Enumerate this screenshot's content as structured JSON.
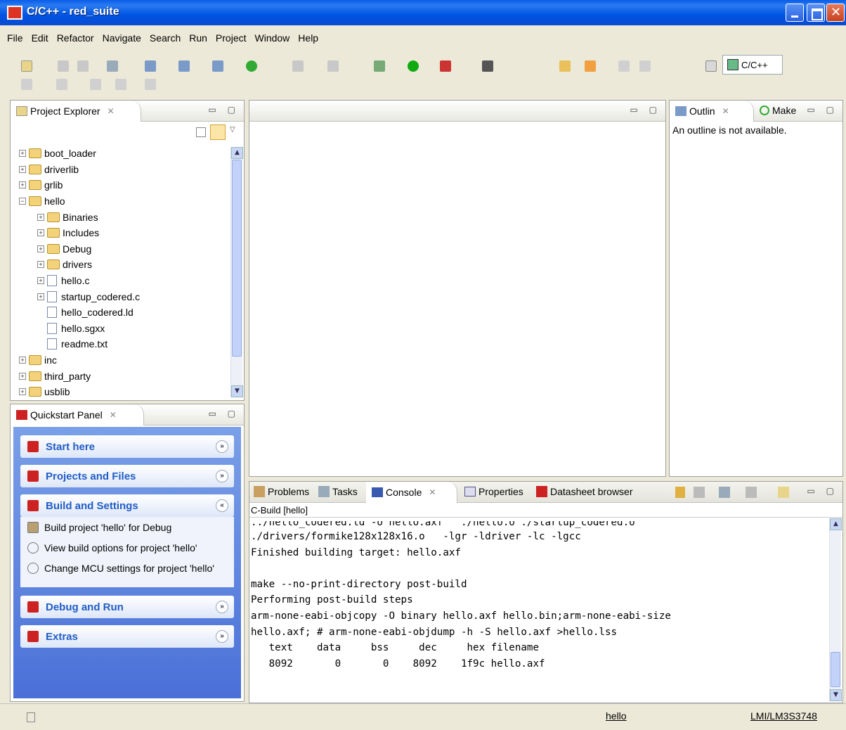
{
  "window": {
    "title": "C/C++ - red_suite"
  },
  "menu": [
    "File",
    "Edit",
    "Refactor",
    "Navigate",
    "Search",
    "Run",
    "Project",
    "Window",
    "Help"
  ],
  "perspective": {
    "label": "C/C++"
  },
  "project_explorer": {
    "tab": "Project Explorer",
    "tree": [
      {
        "label": "boot_loader",
        "expander": "+",
        "level": 0,
        "icon": "folder-icon"
      },
      {
        "label": "driverlib",
        "expander": "+",
        "level": 0,
        "icon": "c-project-icon"
      },
      {
        "label": "grlib",
        "expander": "+",
        "level": 0,
        "icon": "c-project-icon"
      },
      {
        "label": "hello",
        "expander": "−",
        "level": 0,
        "icon": "c-project-icon"
      },
      {
        "label": "Binaries",
        "expander": "+",
        "level": 1,
        "icon": "binaries-icon"
      },
      {
        "label": "Includes",
        "expander": "+",
        "level": 1,
        "icon": "includes-icon"
      },
      {
        "label": "Debug",
        "expander": "+",
        "level": 1,
        "icon": "folder-icon"
      },
      {
        "label": "drivers",
        "expander": "+",
        "level": 1,
        "icon": "folder-icon"
      },
      {
        "label": "hello.c",
        "expander": "+",
        "level": 1,
        "icon": "c-file-icon"
      },
      {
        "label": "startup_codered.c",
        "expander": "+",
        "level": 1,
        "icon": "c-file-icon"
      },
      {
        "label": "hello_codered.ld",
        "expander": "",
        "level": 1,
        "icon": "file-icon"
      },
      {
        "label": "hello.sgxx",
        "expander": "",
        "level": 1,
        "icon": "file-icon"
      },
      {
        "label": "readme.txt",
        "expander": "",
        "level": 1,
        "icon": "file-icon"
      },
      {
        "label": "inc",
        "expander": "+",
        "level": 0,
        "icon": "folder-icon"
      },
      {
        "label": "third_party",
        "expander": "+",
        "level": 0,
        "icon": "folder-icon"
      },
      {
        "label": "usblib",
        "expander": "+",
        "level": 0,
        "icon": "c-project-icon"
      }
    ]
  },
  "quickstart": {
    "tab": "Quickstart Panel",
    "sections": [
      {
        "label": "Start here",
        "chevron": "»"
      },
      {
        "label": "Projects and Files",
        "chevron": "»"
      },
      {
        "label": "Build and Settings",
        "chevron": "«"
      },
      {
        "label": "Debug and Run",
        "chevron": "»"
      },
      {
        "label": "Extras",
        "chevron": "»"
      }
    ],
    "build_items": [
      "Build project 'hello' for Debug",
      "View build options for project 'hello'",
      "Change MCU settings for project 'hello'"
    ]
  },
  "outline": {
    "tab1": "Outlin",
    "tab2": "Make",
    "message": "An outline is not available."
  },
  "bottom_tabs": [
    "Problems",
    "Tasks",
    "Console",
    "Properties",
    "Datasheet browser"
  ],
  "console": {
    "title": "C-Build [hello]",
    "lines": [
      "../hello_codered.ld -o\"hello.axf\"  ./hello.o ./startup_codered.o",
      "./drivers/formike128x128x16.o   -lgr -ldriver -lc -lgcc",
      "Finished building target: hello.axf",
      "",
      "make --no-print-directory post-build",
      "Performing post-build steps",
      "arm-none-eabi-objcopy -O binary hello.axf hello.bin;arm-none-eabi-size",
      "hello.axf; # arm-none-eabi-objdump -h -S hello.axf >hello.lss",
      "   text    data     bss     dec     hex filename",
      "   8092       0       0    8092    1f9c hello.axf"
    ]
  },
  "status": {
    "project": "hello",
    "device": "LMI/LM3S3748"
  }
}
